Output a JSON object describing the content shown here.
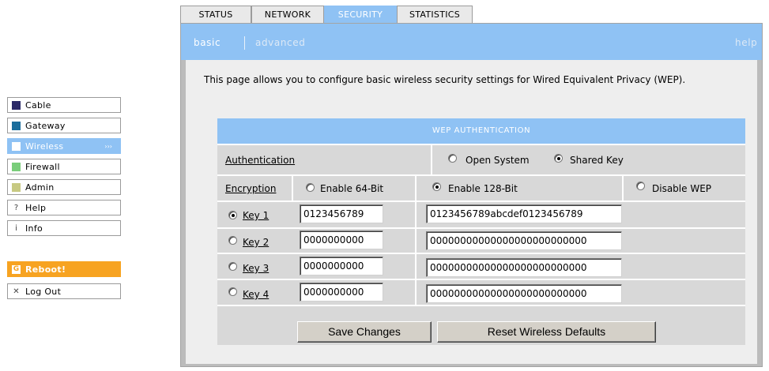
{
  "tabs": [
    {
      "label": "STATUS"
    },
    {
      "label": "NETWORK"
    },
    {
      "label": "SECURITY",
      "active": true
    },
    {
      "label": "STATISTICS"
    }
  ],
  "subnav": {
    "basic": "basic",
    "advanced": "advanced",
    "help": "help"
  },
  "intro": "This page allows you to configure basic wireless security settings for Wired Equivalent Privacy (WEP).",
  "nav": [
    {
      "label": "Cable",
      "icon": "square-swatch-navy",
      "color": "#2b2a68"
    },
    {
      "label": "Gateway",
      "icon": "square-swatch-teal",
      "color": "#1b6d9c"
    },
    {
      "label": "Wireless",
      "icon": "square-swatch-white",
      "color": "#ffffff",
      "active": true,
      "arrow": "›››"
    },
    {
      "label": "Firewall",
      "icon": "square-swatch-green",
      "color": "#79cd7a"
    },
    {
      "label": "Admin",
      "icon": "square-swatch-olive",
      "color": "#c7c982"
    },
    {
      "label": "Help",
      "icon": "question-mark-icon",
      "glyph": "?"
    },
    {
      "label": "Info",
      "icon": "info-icon",
      "glyph": "i"
    },
    {
      "label": "Reboot!",
      "icon": "reboot-icon",
      "glyph": "G"
    },
    {
      "label": "Log Out",
      "icon": "close-x-icon",
      "glyph": "✕"
    }
  ],
  "wep": {
    "header": "WEP AUTHENTICATION",
    "authentication_label": "Authentication",
    "auth_options": [
      {
        "label": "Open System",
        "selected": false
      },
      {
        "label": "Shared Key",
        "selected": true
      }
    ],
    "encryption_label": "Encryption",
    "enc_options": [
      {
        "label": "Enable 64-Bit",
        "selected": false
      },
      {
        "label": "Enable 128-Bit",
        "selected": true
      },
      {
        "label": "Disable WEP",
        "selected": false
      }
    ],
    "keys": [
      {
        "label": "Key 1",
        "selected": true,
        "key64": "0123456789",
        "key128": "0123456789abcdef0123456789"
      },
      {
        "label": "Key 2",
        "selected": false,
        "key64": "0000000000",
        "key128": "00000000000000000000000000"
      },
      {
        "label": "Key 3",
        "selected": false,
        "key64": "0000000000",
        "key128": "00000000000000000000000000"
      },
      {
        "label": "Key 4",
        "selected": false,
        "key64": "0000000000",
        "key128": "00000000000000000000000000"
      }
    ]
  },
  "buttons": {
    "save": "Save Changes",
    "reset": "Reset Wireless Defaults"
  },
  "colors": {
    "accent": "#8fc2f4",
    "reboot": "#f7a321"
  }
}
